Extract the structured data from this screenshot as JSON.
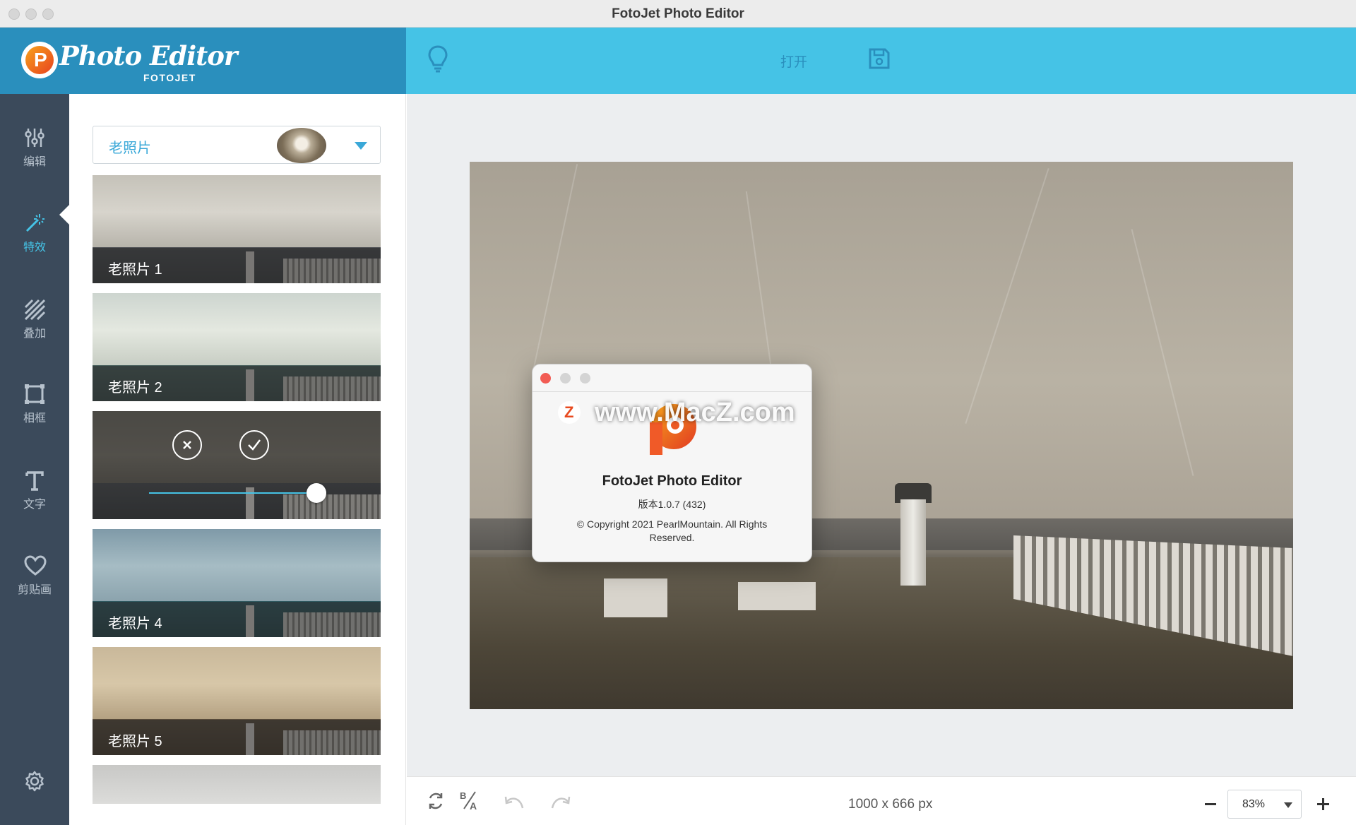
{
  "window": {
    "title": "FotoJet Photo Editor"
  },
  "brand": {
    "logo_text": "Photo Editor",
    "logo_sub": "FOTOJET",
    "logo_glyph": "P"
  },
  "toolbar": {
    "open_label": "打开",
    "bulb_icon": "lightbulb-icon",
    "save_icon": "save-icon"
  },
  "nav": {
    "items": [
      {
        "label": "编辑",
        "icon": "sliders-icon"
      },
      {
        "label": "特效",
        "icon": "magic-wand-icon",
        "active": true
      },
      {
        "label": "叠加",
        "icon": "overlay-stripes-icon"
      },
      {
        "label": "相框",
        "icon": "frame-icon"
      },
      {
        "label": "文字",
        "icon": "text-icon"
      },
      {
        "label": "剪贴画",
        "icon": "heart-icon"
      }
    ],
    "settings_icon": "gear-icon"
  },
  "effects": {
    "category": "老照片",
    "items": [
      {
        "name": "老照片 1"
      },
      {
        "name": "老照片 2"
      },
      {
        "name": "",
        "active": true,
        "intensity": 0.88
      },
      {
        "name": "老照片 4"
      },
      {
        "name": "老照片 5"
      },
      {
        "name": ""
      }
    ]
  },
  "about": {
    "app_name": "FotoJet Photo Editor",
    "version": "版本1.0.7 (432)",
    "copyright": "© Copyright 2021 PearlMountain. All Rights Reserved."
  },
  "watermark": {
    "text": "www.MacZ.com",
    "glyph": "Z"
  },
  "status": {
    "dimensions": "1000 x 666 px",
    "zoom": "83%"
  },
  "colors": {
    "accent": "#45c3e6",
    "nav_bg": "#3b4a5b",
    "brand_dark": "#2a8fbd"
  }
}
